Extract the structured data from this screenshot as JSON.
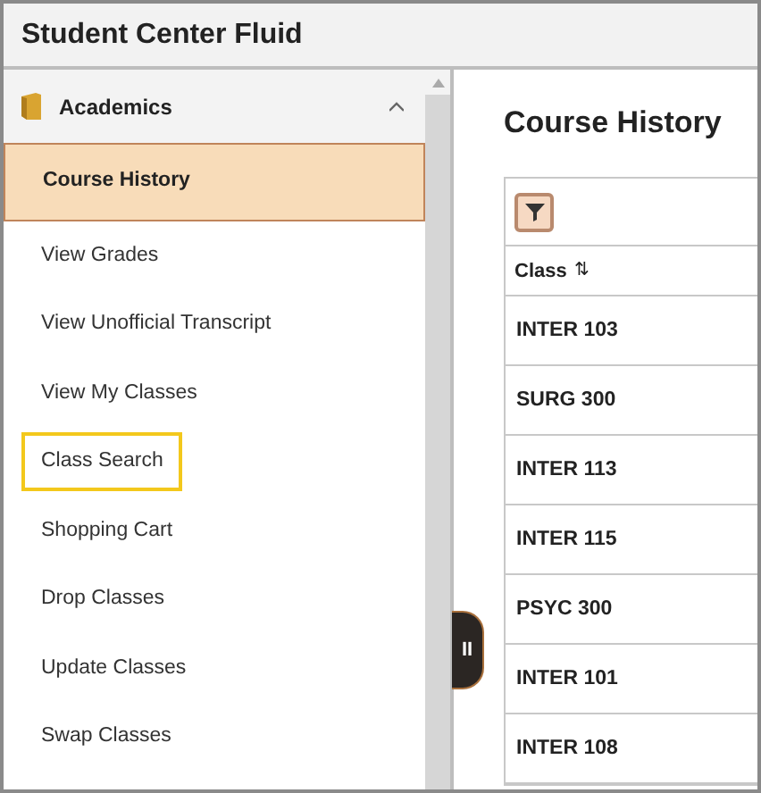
{
  "window": {
    "title": "Student Center Fluid"
  },
  "sidebar": {
    "section": {
      "label": "Academics",
      "expanded": true
    },
    "items": [
      {
        "label": "Course History",
        "selected": true,
        "highlighted": false
      },
      {
        "label": "View Grades",
        "selected": false,
        "highlighted": false
      },
      {
        "label": "View Unofficial Transcript",
        "selected": false,
        "highlighted": false
      },
      {
        "label": "View My Classes",
        "selected": false,
        "highlighted": false
      },
      {
        "label": "Class Search",
        "selected": false,
        "highlighted": true
      },
      {
        "label": "Shopping Cart",
        "selected": false,
        "highlighted": false
      },
      {
        "label": "Drop Classes",
        "selected": false,
        "highlighted": false
      },
      {
        "label": "Update Classes",
        "selected": false,
        "highlighted": false
      },
      {
        "label": "Swap Classes",
        "selected": false,
        "highlighted": false
      }
    ]
  },
  "collapse_handle": {
    "label": "II"
  },
  "content": {
    "title": "Course History",
    "table": {
      "columns": [
        {
          "label": "Class",
          "sort_icon": "⇅"
        }
      ],
      "rows": [
        [
          "INTER 103"
        ],
        [
          "SURG 300"
        ],
        [
          "INTER 113"
        ],
        [
          "INTER 115"
        ],
        [
          "PSYC 300"
        ],
        [
          "INTER 101"
        ],
        [
          "INTER 108"
        ]
      ]
    }
  }
}
